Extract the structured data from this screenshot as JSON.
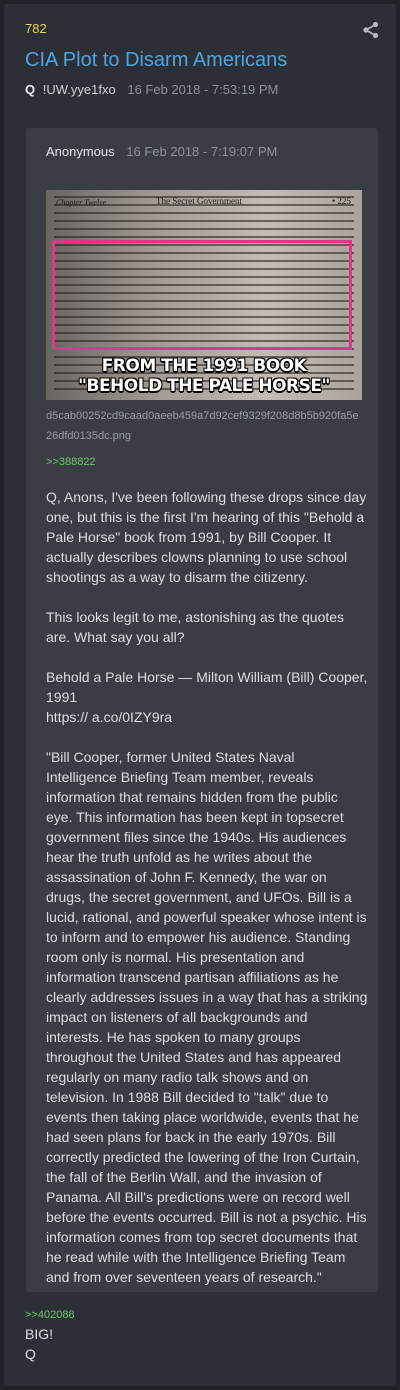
{
  "post": {
    "number": "782",
    "title": "CIA Plot to Disarm Americans",
    "author": "Q",
    "tripcode": "!UW.yye1fxo",
    "date": "16 Feb 2018 - 7:53:19 PM"
  },
  "quoted": {
    "author": "Anonymous",
    "date": "16 Feb 2018 - 7:19:07 PM",
    "image": {
      "header_left": "Chapter Twelve",
      "header_center": "The Secret Government",
      "header_page": "• 225",
      "caption_line1": "FROM THE 1991 BOOK",
      "caption_line2": "\"BEHOLD THE PALE HORSE\""
    },
    "filename": "d5cab00252cd9caad0aeeb459a7d92cef9329f208d8b5b920fa5e26dfd0135dc.png",
    "reply_link": ">>388822",
    "paragraphs": [
      "Q, Anons, I've been following these drops since day one, but this is the first I'm hearing of this \"Behold a Pale Horse\" book from 1991, by Bill Cooper. It actually describes clowns planning to use school shootings as a way to disarm the citizenry.",
      "This looks legit to me, astonishing as the quotes are. What say you all?",
      "Behold a Pale Horse — Milton William (Bill) Cooper, 1991\nhttps:// a.co/0IZY9ra",
      "\"Bill Cooper, former United States Naval Intelligence Briefing Team member, reveals information that remains hidden from the public eye. This information has been kept in topsecret government files since the 1940s. His audiences hear the truth unfold as he writes about the assassination of John F. Kennedy, the war on drugs, the secret government, and UFOs. Bill is a lucid, rational, and powerful speaker whose intent is to inform and to empower his audience. Standing room only is normal. His presentation and information transcend partisan affiliations as he clearly addresses issues in a way that has a striking impact on listeners of all backgrounds and interests. He has spoken to many groups throughout the United States and has appeared regularly on many radio talk shows and on television. In 1988 Bill decided to \"talk\" due to events then taking place worldwide, events that he had seen plans for back in the early 1970s. Bill correctly predicted the lowering of the Iron Curtain, the fall of the Berlin Wall, and the invasion of Panama. All Bill's predictions were on record well before the events occurred. Bill is not a psychic. His information comes from top secret documents that he read while with the Intelligence Briefing Team and from over seventeen years of research.\""
    ]
  },
  "reply": {
    "link": ">>402088",
    "text": "BIG!\nQ"
  },
  "icons": {
    "share": "share-icon"
  },
  "colors": {
    "accent": "#4fa4e0",
    "number": "#e8d35a",
    "link": "#6cc66c",
    "highlight": "#d93a86"
  }
}
